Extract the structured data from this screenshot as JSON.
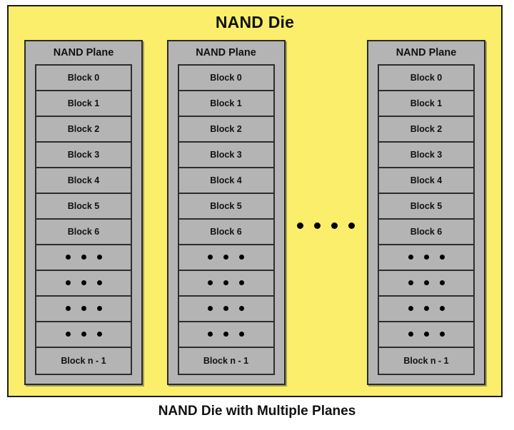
{
  "figure": {
    "caption": "NAND Die with Multiple Planes",
    "colors": {
      "die_fill": "#faee6b",
      "plane_fill": "#b4b4b4",
      "border": "#1c1c1c",
      "text": "#111111",
      "dot": "#000000",
      "page_background": "#ffffff"
    }
  },
  "die": {
    "title": "NAND Die",
    "planes": [
      {
        "title": "NAND Plane",
        "blocks": [
          {
            "type": "label",
            "label": "Block 0"
          },
          {
            "type": "label",
            "label": "Block 1"
          },
          {
            "type": "label",
            "label": "Block 2"
          },
          {
            "type": "label",
            "label": "Block 3"
          },
          {
            "type": "label",
            "label": "Block 4"
          },
          {
            "type": "label",
            "label": "Block 5"
          },
          {
            "type": "label",
            "label": "Block 6"
          },
          {
            "type": "ellipsis",
            "label": ""
          },
          {
            "type": "ellipsis",
            "label": ""
          },
          {
            "type": "ellipsis",
            "label": ""
          },
          {
            "type": "ellipsis",
            "label": ""
          },
          {
            "type": "label",
            "label": "Block n - 1"
          }
        ]
      },
      {
        "title": "NAND Plane",
        "blocks": [
          {
            "type": "label",
            "label": "Block 0"
          },
          {
            "type": "label",
            "label": "Block 1"
          },
          {
            "type": "label",
            "label": "Block 2"
          },
          {
            "type": "label",
            "label": "Block 3"
          },
          {
            "type": "label",
            "label": "Block 4"
          },
          {
            "type": "label",
            "label": "Block 5"
          },
          {
            "type": "label",
            "label": "Block 6"
          },
          {
            "type": "ellipsis",
            "label": ""
          },
          {
            "type": "ellipsis",
            "label": ""
          },
          {
            "type": "ellipsis",
            "label": ""
          },
          {
            "type": "ellipsis",
            "label": ""
          },
          {
            "type": "label",
            "label": "Block n - 1"
          }
        ]
      },
      {
        "title": "NAND Plane",
        "blocks": [
          {
            "type": "label",
            "label": "Block 0"
          },
          {
            "type": "label",
            "label": "Block 1"
          },
          {
            "type": "label",
            "label": "Block 2"
          },
          {
            "type": "label",
            "label": "Block 3"
          },
          {
            "type": "label",
            "label": "Block 4"
          },
          {
            "type": "label",
            "label": "Block 5"
          },
          {
            "type": "label",
            "label": "Block 6"
          },
          {
            "type": "ellipsis",
            "label": ""
          },
          {
            "type": "ellipsis",
            "label": ""
          },
          {
            "type": "ellipsis",
            "label": ""
          },
          {
            "type": "ellipsis",
            "label": ""
          },
          {
            "type": "label",
            "label": "Block n - 1"
          }
        ]
      }
    ],
    "plane_ellipsis": {
      "name": "more-planes-ellipsis",
      "dot_count": 4
    }
  }
}
